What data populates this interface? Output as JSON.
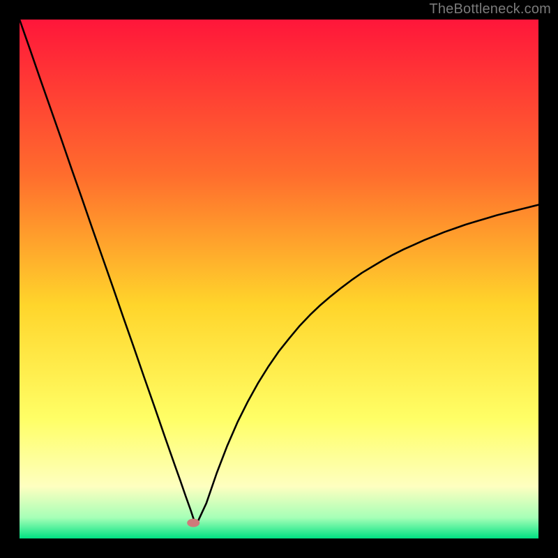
{
  "watermark": "TheBottleneck.com",
  "colors": {
    "bg": "#000000",
    "curve": "#000000",
    "marker_fill": "#cf7a7a",
    "marker_stroke": "#b66",
    "grad_top": "#ff163a",
    "grad_mid1": "#ff7a2b",
    "grad_mid2": "#ffd52b",
    "grad_mid3": "#ffff66",
    "grad_bottom1": "#feffc0",
    "grad_bottom2": "#7dffb0",
    "grad_bottom3": "#00e283"
  },
  "chart_data": {
    "type": "line",
    "title": "",
    "xlabel": "",
    "ylabel": "",
    "xlim": [
      0,
      100
    ],
    "ylim": [
      0,
      100
    ],
    "grid": false,
    "x": [
      0,
      2,
      4,
      6,
      8,
      10,
      12,
      14,
      16,
      18,
      20,
      22,
      24,
      26,
      28,
      30,
      31,
      32,
      33,
      33.5,
      34,
      36,
      38,
      40,
      42,
      44,
      46,
      48,
      50,
      52,
      54,
      56,
      58,
      60,
      62,
      64,
      66,
      68,
      70,
      72,
      74,
      76,
      78,
      80,
      82,
      84,
      86,
      88,
      90,
      92,
      94,
      96,
      98,
      100
    ],
    "values": [
      100,
      94.3,
      88.5,
      82.8,
      77.1,
      71.3,
      65.6,
      59.8,
      54.1,
      48.4,
      42.6,
      36.9,
      31.1,
      25.4,
      19.6,
      13.9,
      11.1,
      8.2,
      5.4,
      3.9,
      2.5,
      6.8,
      12.6,
      17.8,
      22.4,
      26.4,
      30.0,
      33.2,
      36.1,
      38.6,
      41.0,
      43.1,
      45.0,
      46.7,
      48.3,
      49.8,
      51.2,
      52.4,
      53.6,
      54.7,
      55.7,
      56.6,
      57.5,
      58.3,
      59.1,
      59.8,
      60.5,
      61.1,
      61.7,
      62.3,
      62.8,
      63.3,
      63.8,
      64.3
    ],
    "marker": {
      "x": 33.5,
      "y": 3.0
    },
    "gradient_stops": [
      {
        "offset": 0.0,
        "color": "#ff163a"
      },
      {
        "offset": 0.3,
        "color": "#ff6d2d"
      },
      {
        "offset": 0.55,
        "color": "#ffd52b"
      },
      {
        "offset": 0.77,
        "color": "#ffff66"
      },
      {
        "offset": 0.9,
        "color": "#feffc0"
      },
      {
        "offset": 0.96,
        "color": "#a6ffb7"
      },
      {
        "offset": 1.0,
        "color": "#00e283"
      }
    ]
  }
}
